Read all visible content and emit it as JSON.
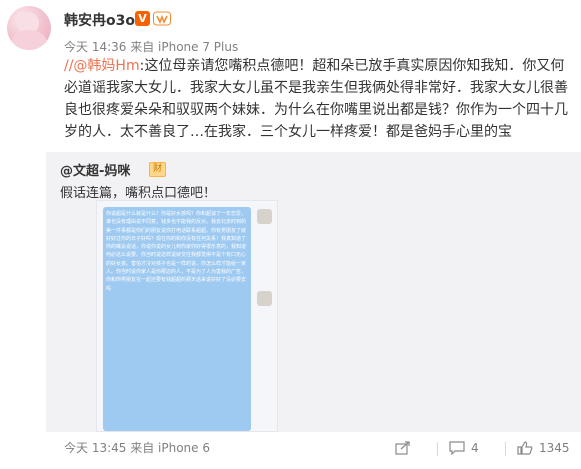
{
  "post": {
    "author": "韩安冉o3o",
    "vip_badge": "V",
    "meta": "今天 14:36 来自 iPhone 7 Plus",
    "mention": "//@韩妈Hm",
    "text": ":这位母亲请您嘴积点德吧！超和朵已放手真实原因你知我知．你又何必道谣我家大女儿．我家大女儿虽不是我亲生但我俩处得非常好．我家大女儿很善良也很疼爱朵朵和驭驭两个妹妹．为什么在你嘴里说出都是钱？你作为一个四十几岁的人．太不善良了…在我家．三个女儿一样疼爱！都是爸妈手心里的宝"
  },
  "repost": {
    "author": "@文超-妈咪",
    "ad_badge": "财",
    "text": "假话连篇，嘴积点口德吧！",
    "chat_text": "你说超是什么就是什么？你是好女孩吗？你和超谈了一年恋爱，谁也没有理由说不同意，钱多也不能我的反对。我去北京时到的美一件事都是你们的朋友说你打电话联系超超。你有男朋友了就好好过你的日子好吗？现在你的和你没有任何关系！我真知道了你的嘴会说话，你说你说的女儿到你家你好得很乐意的，我知道何必这么说要。你当时说这样说就交往我都觉得不是个有口无心的好女孩。害怕才冷对孩子也是一样的说，你怎么样才能给一家人。你当时说你家人是你那边的人，不是为了人为害我的广告，你和你男朋友在一起还要有钱超超的那天话来说好好了没必要去吗"
  },
  "footer": {
    "meta": "今天 13:45 来自 iPhone 6",
    "share_count": "",
    "comment_count": "4",
    "like_count": "1345"
  }
}
